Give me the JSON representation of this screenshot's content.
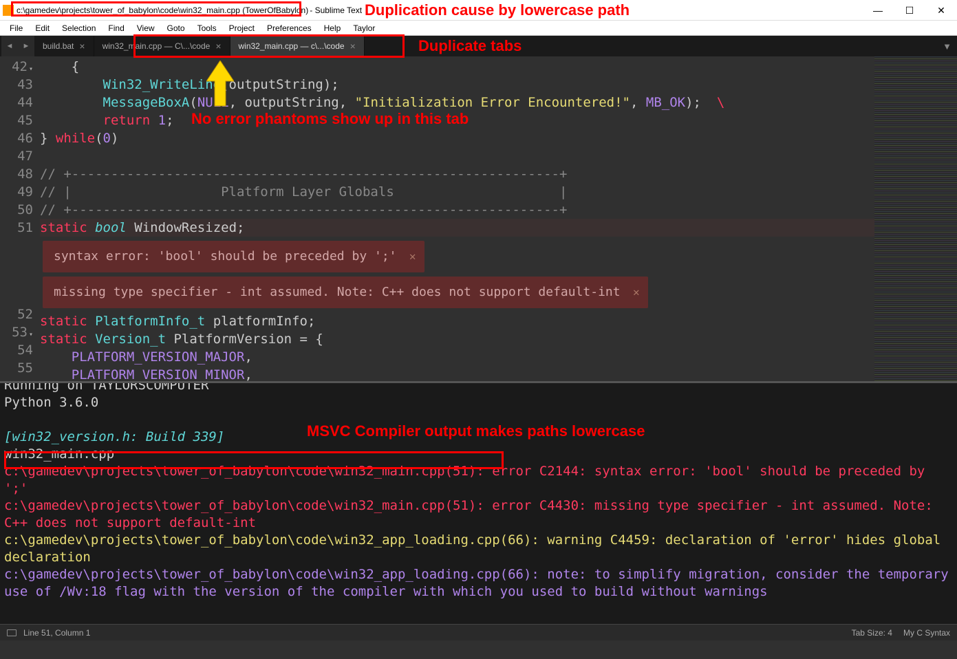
{
  "window": {
    "title_path": "c:\\gamedev\\projects\\tower_of_babylon\\code\\win32_main.cpp (TowerOfBabylon)",
    "title_app": "- Sublime Text",
    "minimize": "—",
    "maximize": "☐",
    "close": "✕"
  },
  "menu": {
    "items": [
      "File",
      "Edit",
      "Selection",
      "Find",
      "View",
      "Goto",
      "Tools",
      "Project",
      "Preferences",
      "Help",
      "Taylor"
    ]
  },
  "tabs": {
    "prev": "◄",
    "next": "►",
    "end": "▼",
    "items": [
      {
        "label": "build.bat",
        "close": "×",
        "active": false
      },
      {
        "label": "win32_main.cpp — C\\...\\code",
        "close": "×",
        "active": false
      },
      {
        "label": "win32_main.cpp — c\\...\\code",
        "close": "×",
        "active": true
      }
    ]
  },
  "code": {
    "lines": [
      {
        "n": "42",
        "html": "<span class='kw-paren'>{</span>",
        "fold": true,
        "indent": 1
      },
      {
        "n": "43",
        "html": "<span class='kw-teal'>Win32_WriteLine</span>(outputString);",
        "indent": 2
      },
      {
        "n": "44",
        "html": "<span class='kw-teal'>MessageBoxA</span>(<span class='kw-const'>NULL</span>, outputString, <span class='kw-str'>\"Initialization Error Encountered!\"</span>, <span class='kw-const'>MB_OK</span>);  <span class='kw-bs'>\\</span>",
        "indent": 2
      },
      {
        "n": "45",
        "html": "<span class='kw-red'>return</span> <span class='kw-num'>1</span>;",
        "indent": 2
      },
      {
        "n": "46",
        "html": "} <span class='kw-red'>while</span>(<span class='kw-num'>0</span>)",
        "indent": 0
      },
      {
        "n": "47",
        "html": "",
        "indent": 0
      },
      {
        "n": "48",
        "html": "<span class='kw-comment'>// +--------------------------------------------------------------+</span>",
        "indent": 0
      },
      {
        "n": "49",
        "html": "<span class='kw-comment'>// |                   Platform Layer Globals                     |</span>",
        "indent": 0
      },
      {
        "n": "50",
        "html": "<span class='kw-comment'>// +--------------------------------------------------------------+</span>",
        "indent": 0
      },
      {
        "n": "51",
        "html": "<span class='kw-red'>static</span> <span class='kw-type'>bool</span> WindowResized;",
        "hl": true,
        "indent": 0
      }
    ],
    "phantoms": [
      {
        "text": "syntax error: 'bool' should be preceded by ';'",
        "close": "✕"
      },
      {
        "text": "missing type specifier - int assumed. Note: C++ does not support default-int",
        "close": "✕"
      }
    ],
    "lines_after": [
      {
        "n": "52",
        "html": "<span class='kw-red'>static</span> <span class='kw-teal'>PlatformInfo_t</span> platformInfo;",
        "indent": 0
      },
      {
        "n": "53",
        "html": "<span class='kw-red'>static</span> <span class='kw-teal'>Version_t</span> PlatformVersion = {",
        "fold": true,
        "indent": 0
      },
      {
        "n": "54",
        "html": "<span class='kw-const'>PLATFORM_VERSION_MAJOR</span>,",
        "indent": 1
      },
      {
        "n": "55",
        "html": "<span class='kw-const'>PLATFORM_VERSION_MINOR</span>,",
        "indent": 1
      }
    ]
  },
  "console": {
    "lines": [
      {
        "cls": "c-white",
        "text": "Running on TAYLORSCOMPUTER"
      },
      {
        "cls": "c-white",
        "text": "Python 3.6.0"
      },
      {
        "cls": "",
        "text": " "
      },
      {
        "cls": "c-teal",
        "text": "[win32_version.h: Build 339]"
      },
      {
        "cls": "c-white",
        "text": "win32_main.cpp"
      },
      {
        "cls": "c-red",
        "text": "c:\\gamedev\\projects\\tower_of_babylon\\code\\win32_main.cpp(51): error C2144: syntax error: 'bool' should be preceded by ';'"
      },
      {
        "cls": "c-red",
        "text": "c:\\gamedev\\projects\\tower_of_babylon\\code\\win32_main.cpp(51): error C4430: missing type specifier - int assumed. Note: C++ does not support default-int"
      },
      {
        "cls": "c-yellow",
        "text": "c:\\gamedev\\projects\\tower_of_babylon\\code\\win32_app_loading.cpp(66): warning C4459: declaration of 'error' hides global declaration"
      },
      {
        "cls": "c-purple",
        "text": "c:\\gamedev\\projects\\tower_of_babylon\\code\\win32_app_loading.cpp(66): note: to simplify migration, consider the temporary use of /Wv:18 flag with the version of the compiler with which you used to build without warnings"
      }
    ]
  },
  "status": {
    "pos": "Line 51, Column 1",
    "tabsize": "Tab Size: 4",
    "syntax": "My C Syntax"
  },
  "annotations": {
    "title_note": "Duplication cause by lowercase path",
    "tabs_note": "Duplicate tabs",
    "editor_note": "No error phantoms show up in this tab",
    "console_note": "MSVC Compiler output makes paths lowercase"
  }
}
